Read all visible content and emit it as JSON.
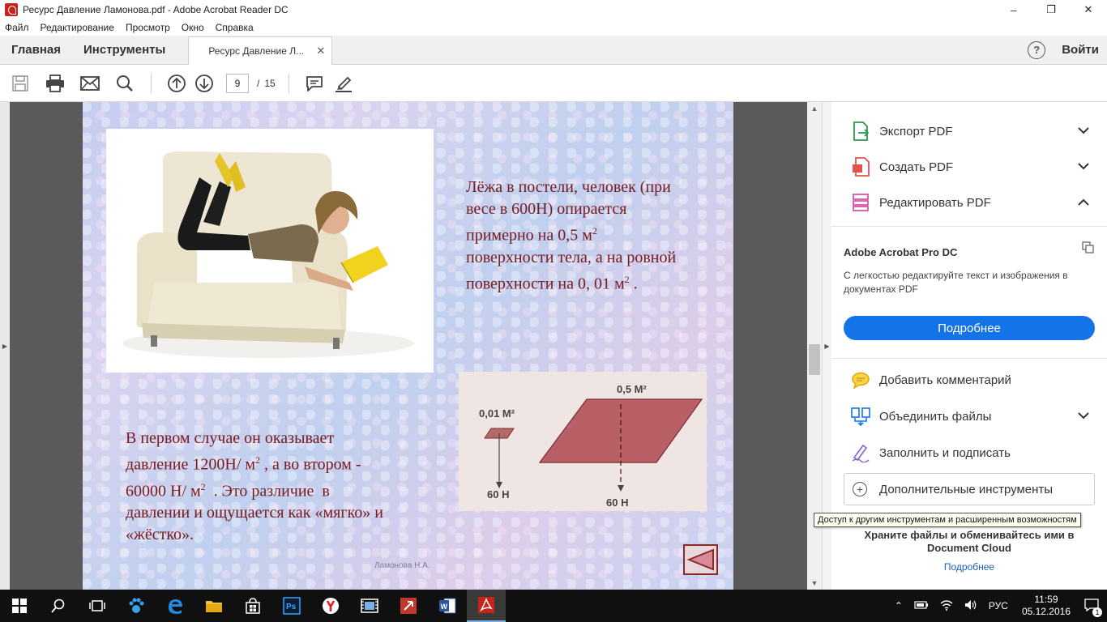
{
  "window": {
    "title": "Ресурс Давление Ламонова.pdf - Adobe Acrobat Reader DC",
    "controls": [
      "–",
      "❐",
      "✕"
    ]
  },
  "menu": {
    "items": [
      "Файл",
      "Редактирование",
      "Просмотр",
      "Окно",
      "Справка"
    ]
  },
  "tabs": {
    "home": "Главная",
    "tools": "Инструменты",
    "document": "Ресурс Давление Л...",
    "close": "✕",
    "help": "?",
    "signin": "Войти"
  },
  "toolbar": {
    "current_page": "9",
    "separator": "/",
    "total_pages": "15"
  },
  "slide": {
    "text_top": {
      "line1": "Лёжа в постели, человек (при",
      "line2": "весе в 600Н) опирается",
      "line3_pre": "примерно на 0,5 м",
      "sup1": "2",
      "line4": "поверхности тела, а на ровной",
      "line5_pre": "поверхности на 0, 01 м",
      "sup2": "2",
      "line5_post": " ."
    },
    "text_bottom": {
      "line1": "В первом случае он оказывает",
      "line2_pre": "давление 1200Н/ м",
      "sup1": "2",
      "line2_post": " , а во втором -",
      "line3_pre": "60000 Н/ м",
      "sup2": "2",
      "line3_post": "  . Это различие  в",
      "line4": "давлении и ощущается как «мягко» и",
      "line5": "«жёстко»."
    },
    "diagram": {
      "small_area": "0,01 М²",
      "small_force": "60 Н",
      "large_area": "0,5 М²",
      "large_force": "60 Н"
    },
    "footer": "Ламонова Н.А."
  },
  "right_pane": {
    "tools": [
      {
        "label": "Экспорт PDF",
        "icon": "export-pdf-icon",
        "chevron": "⌄"
      },
      {
        "label": "Создать PDF",
        "icon": "create-pdf-icon",
        "chevron": "⌄"
      },
      {
        "label": "Редактировать PDF",
        "icon": "edit-pdf-icon",
        "chevron": "⌃"
      }
    ],
    "promo": {
      "title": "Adobe Acrobat Pro DC",
      "description": "С легкостью редактируйте текст и изображения в документах PDF",
      "button": "Подробнее"
    },
    "tools2": [
      {
        "label": "Добавить комментарий",
        "icon": "comment-icon"
      },
      {
        "label": "Объединить файлы",
        "icon": "combine-files-icon",
        "chevron": "⌄"
      },
      {
        "label": "Заполнить и подписать",
        "icon": "fill-sign-icon"
      }
    ],
    "more_tools": "Дополнительные инструменты",
    "cloud": {
      "line1": "Храните файлы и обменивайтесь ими в",
      "line2": "Document Cloud",
      "link": "Подробнее"
    }
  },
  "tooltip": "Доступ к другим инструментам и расширенным возможностям",
  "taskbar": {
    "language": "РУС",
    "time": "11:59",
    "date": "05.12.2016",
    "notifications": "1"
  },
  "colors": {
    "accent_blue": "#1473e6",
    "slide_text": "#7a1a1f",
    "acrobat_red": "#c8231b"
  }
}
